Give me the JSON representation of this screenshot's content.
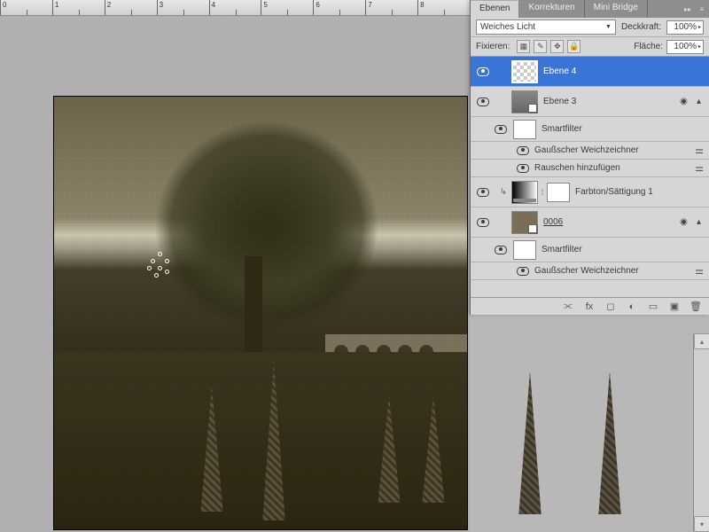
{
  "ruler": {
    "marks": [
      "0",
      "1",
      "2",
      "3",
      "4",
      "5",
      "6",
      "7",
      "8"
    ]
  },
  "panel": {
    "tabs": {
      "layers": "Ebenen",
      "adjustments": "Korrekturen",
      "minibridge": "Mini Bridge"
    },
    "blend": {
      "mode": "Weiches Licht",
      "opacity_label": "Deckkraft:",
      "opacity_value": "100%"
    },
    "lock": {
      "label": "Fixieren:",
      "fill_label": "Fläche:",
      "fill_value": "100%"
    },
    "layers": [
      {
        "name": "Ebene 4",
        "selected": true
      },
      {
        "name": "Ebene 3",
        "smart": true,
        "filters_label": "Smartfilter",
        "filters": [
          "Gaußscher Weichzeichner",
          "Rauschen hinzufügen"
        ]
      },
      {
        "name": "Farbton/Sättigung 1",
        "adjustment": true,
        "clipped": true
      },
      {
        "name": "0006",
        "smart": true,
        "linkstyle": true,
        "filters_label": "Smartfilter",
        "filters": [
          "Gaußscher Weichzeichner"
        ]
      }
    ]
  }
}
